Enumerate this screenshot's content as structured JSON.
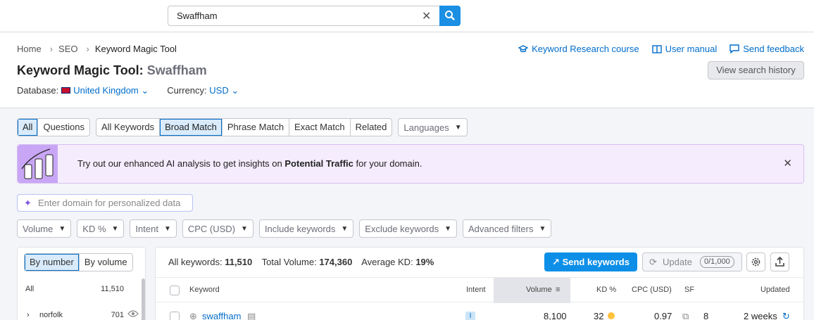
{
  "search": {
    "value": "Swaffham"
  },
  "breadcrumb": [
    "Home",
    "SEO",
    "Keyword Magic Tool"
  ],
  "toplinks": {
    "course": "Keyword Research course",
    "manual": "User manual",
    "feedback": "Send feedback"
  },
  "title": {
    "main": "Keyword Magic Tool:",
    "keyword": "Swaffham"
  },
  "history_button": "View search history",
  "database": {
    "label": "Database:",
    "value": "United Kingdom"
  },
  "currency": {
    "label": "Currency:",
    "value": "USD"
  },
  "segment1": [
    "All",
    "Questions"
  ],
  "segment2": [
    "All Keywords",
    "Broad Match",
    "Phrase Match",
    "Exact Match",
    "Related"
  ],
  "languages": "Languages",
  "banner": {
    "pre": "Try out our enhanced AI analysis to get insights on",
    "bold": "Potential Traffic",
    "post": "for your domain."
  },
  "domain_placeholder": "Enter domain for personalized data",
  "filters": [
    "Volume",
    "KD %",
    "Intent",
    "CPC (USD)",
    "Include keywords",
    "Exclude keywords",
    "Advanced filters"
  ],
  "leftpanel": {
    "tabs": [
      "By number",
      "By volume"
    ],
    "rows": [
      {
        "name": "All",
        "count": "11,510"
      },
      {
        "name": "norfolk",
        "count": "701"
      }
    ]
  },
  "table": {
    "summary": {
      "all_label": "All keywords:",
      "all": "11,510",
      "vol_label": "Total Volume:",
      "vol": "174,360",
      "kd_label": "Average KD:",
      "kd": "19%"
    },
    "send": "Send keywords",
    "update": "Update",
    "update_count": "0/1,000",
    "headers": {
      "keyword": "Keyword",
      "intent": "Intent",
      "volume": "Volume",
      "kd": "KD %",
      "cpc": "CPC (USD)",
      "sf": "SF",
      "updated": "Updated"
    },
    "row": {
      "keyword": "swaffham",
      "intent": "I",
      "volume": "8,100",
      "kd": "32",
      "cpc": "0.97",
      "sf": "8",
      "updated": "2 weeks"
    }
  },
  "colors": {
    "accent": "#1a8fe3",
    "link": "#006dca",
    "banner_bg": "#f5ecfd",
    "kd_dot": "#ffc13b"
  }
}
